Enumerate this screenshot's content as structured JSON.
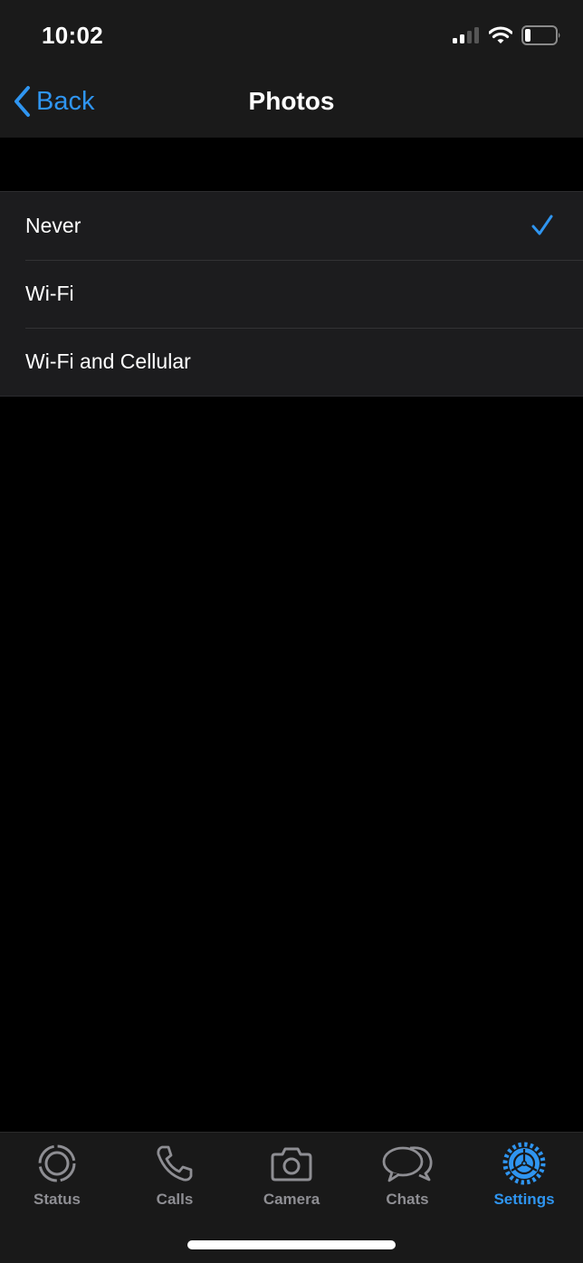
{
  "status_bar": {
    "time": "10:02",
    "signal_icon": "cellular-signal-icon",
    "wifi_icon": "wifi-icon",
    "battery_icon": "battery-icon",
    "battery_level_fraction": 0.15
  },
  "nav": {
    "back_label": "Back",
    "back_icon": "chevron-left-icon",
    "title": "Photos"
  },
  "options": [
    {
      "label": "Never",
      "selected": true
    },
    {
      "label": "Wi-Fi",
      "selected": false
    },
    {
      "label": "Wi-Fi and Cellular",
      "selected": false
    }
  ],
  "tabs": [
    {
      "label": "Status",
      "icon": "status-icon",
      "active": false
    },
    {
      "label": "Calls",
      "icon": "phone-icon",
      "active": false
    },
    {
      "label": "Camera",
      "icon": "camera-icon",
      "active": false
    },
    {
      "label": "Chats",
      "icon": "chat-bubbles-icon",
      "active": false
    },
    {
      "label": "Settings",
      "icon": "gear-icon",
      "active": true
    }
  ],
  "colors": {
    "accent": "#2f95f0",
    "inactive": "#8e8e93",
    "background": "#000000",
    "cell": "#1c1c1e"
  }
}
